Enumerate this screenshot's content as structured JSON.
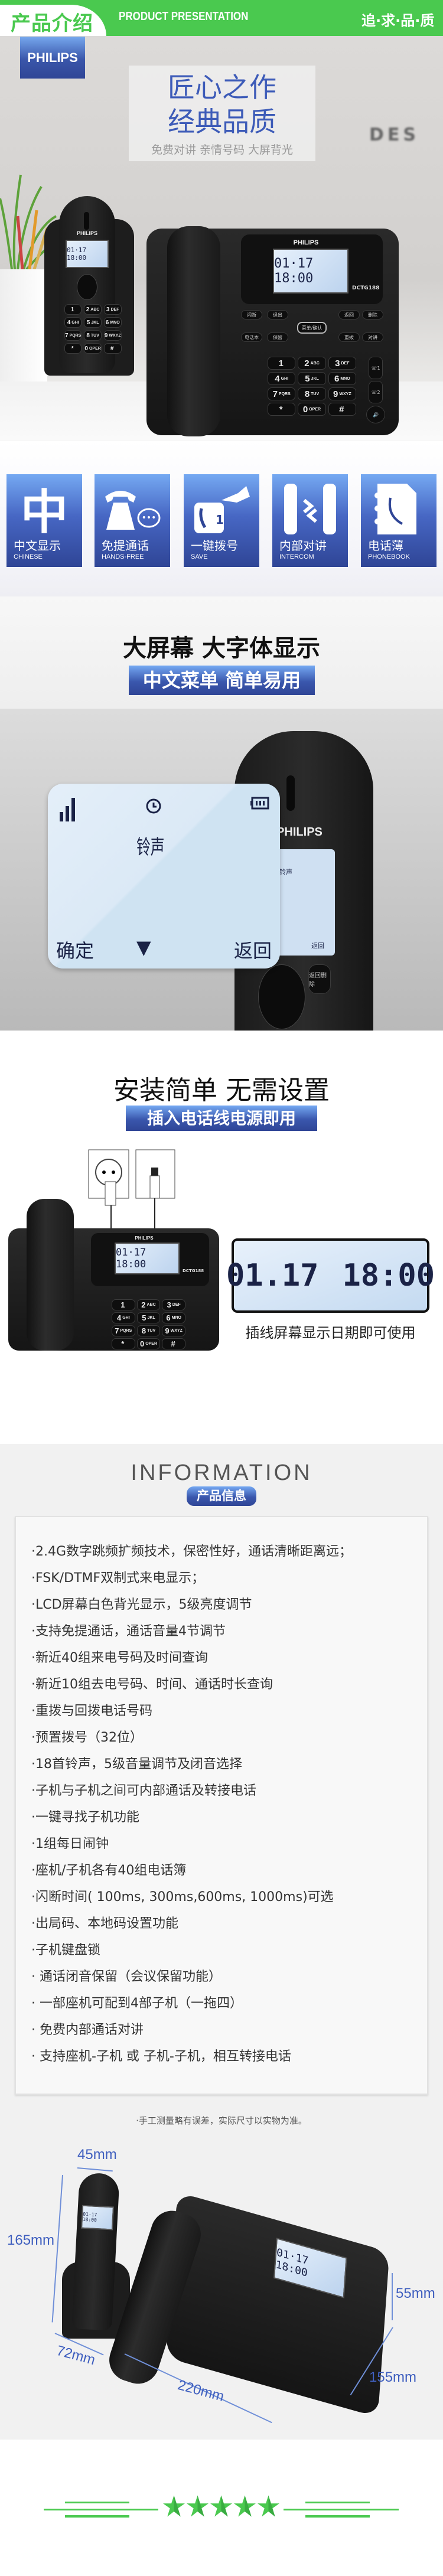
{
  "header": {
    "title_cn": "产品介绍",
    "title_en": "PRODUCT PRESENTATION",
    "motto": "追·求·品·质"
  },
  "hero": {
    "brand": "PHILIPS",
    "headline_1": "匠心之作",
    "headline_2": "经典品质",
    "subline": "免费对讲 亲情号码 大屏背光",
    "background_text": "DES"
  },
  "phone": {
    "brand": "PHILIPS",
    "model": "DCTG188",
    "lcd_time": "01·17 18:00",
    "keys": [
      [
        "1",
        ""
      ],
      [
        "2",
        "ABC"
      ],
      [
        "3",
        "DEF"
      ],
      [
        "4",
        "GHI"
      ],
      [
        "5",
        "JKL"
      ],
      [
        "6",
        "MNO"
      ],
      [
        "7",
        "PQRS"
      ],
      [
        "8",
        "TUV"
      ],
      [
        "9",
        "WXYZ"
      ],
      [
        "*",
        ""
      ],
      [
        "0",
        "OPER"
      ],
      [
        "#",
        ""
      ]
    ],
    "desk_fkeys": [
      "闪断",
      "退出",
      "菜单/确认",
      "返回",
      "删除",
      "电话本",
      "保留",
      "重拨",
      "对讲"
    ],
    "handset_fkeys": [
      "内部",
      "重拨",
      "对讲",
      "返回删除"
    ]
  },
  "features_icons": [
    {
      "icon": "chinese-character-icon",
      "glyph": "中",
      "label": "中文显示",
      "label_en": "CHINESE"
    },
    {
      "icon": "phone-speech-icon",
      "label": "免提通话",
      "label_en": "HANDS-FREE"
    },
    {
      "icon": "speed-dial-icon",
      "glyph": "1",
      "label": "一键拨号",
      "label_en": "SAVE"
    },
    {
      "icon": "intercom-icon",
      "label": "内部对讲",
      "label_en": "INTERCOM"
    },
    {
      "icon": "phonebook-icon",
      "label": "电话薄",
      "label_en": "PHONEBOOK"
    }
  ],
  "display_section": {
    "title": "大屏幕 大字体显示",
    "banner": "中文菜单 简单易用",
    "screen": {
      "menu_item": "铃声",
      "left_softkey": "确定",
      "arrow": "▼",
      "right_softkey": "返回"
    }
  },
  "install_section": {
    "title": "安装简单 无需设置",
    "banner": "插入电话线电源即用",
    "lcd_date": "01.17",
    "lcd_time": "18:00",
    "caption": "插线屏幕显示日期即可使用"
  },
  "information": {
    "title": "INFORMATION",
    "badge": "产品信息",
    "features": [
      "·2.4G数字跳频扩频技术，保密性好，通话清晰距离远；",
      "·FSK/DTMF双制式来电显示；",
      "·LCD屏幕白色背光显示，5级亮度调节",
      "·支持免提通话，通话音量4节调节",
      "·新近40组来电号码及时间查询",
      "·新近10组去电号码、时间、通话时长查询",
      "·重拨与回拨电话号码",
      "·预置拨号（32位）",
      "·18首铃声，5级音量调节及闭音选择",
      "·子机与子机之间可内部通话及转接电话",
      "·一键寻找子机功能",
      "·1组每日闹钟",
      "·座机/子机各有40组电话簿",
      "·闪断时间( 100ms, 300ms,600ms, 1000ms)可选",
      "·出局码、本地码设置功能",
      "·子机键盘锁",
      "· 通话闭音保留（会议保留功能）",
      "· 一部座机可配到4部子机（一拖四）",
      "· 免费内部通话对讲",
      "· 支持座机-子机 或 子机-子机，相互转接电话"
    ],
    "note": "·手工测量略有误差，实际尺寸以实物为准。"
  },
  "dimensions": {
    "handset_width": "45mm",
    "handset_height": "165mm",
    "cradle_depth": "72mm",
    "base_width": "220mm",
    "base_height": "55mm",
    "base_depth": "155mm"
  },
  "rating": {
    "stars": 5,
    "max": 5
  },
  "colors": {
    "brand_green": "#4ac94f",
    "accent_blue": "#2f4596",
    "accent_blue_light": "#75a9f2",
    "dimension_blue": "#3f5fbf"
  }
}
